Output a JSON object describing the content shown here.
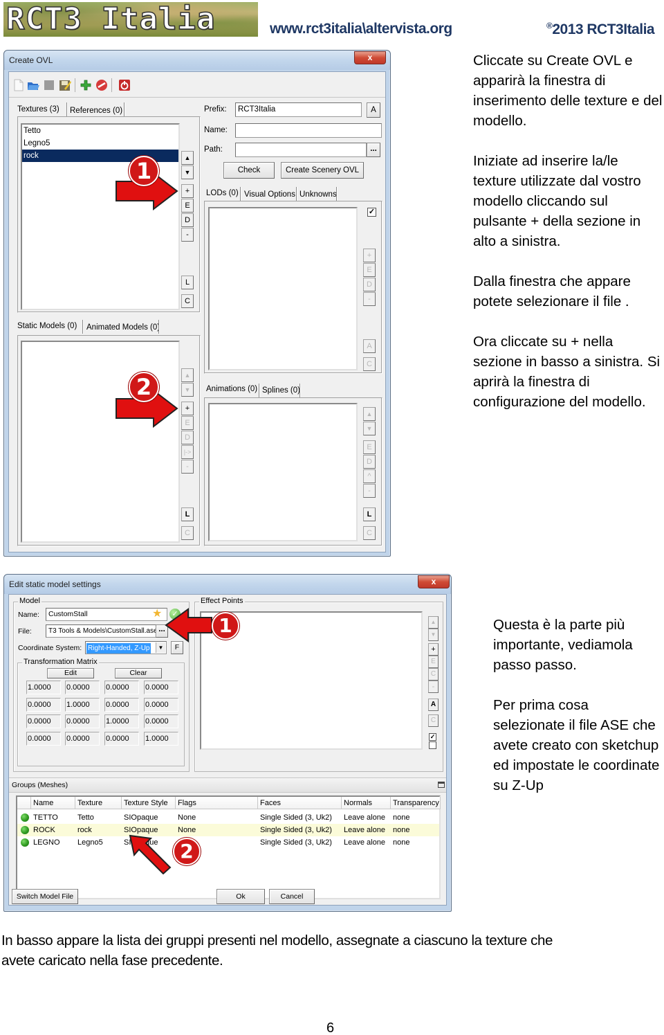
{
  "header": {
    "logo_text": "RCT3 Italia",
    "site_url": "www.rct3italia\\altervista.org",
    "copyright_symbol": "®",
    "copyright_text": "2013 RCT3Italia"
  },
  "dialog1": {
    "title": "Create OVL",
    "close_label": "x",
    "toolbar": [
      {
        "icon": "new-file-icon"
      },
      {
        "icon": "open-folder-icon"
      },
      {
        "icon": "save-disabled-icon"
      },
      {
        "icon": "save-as-icon"
      },
      {
        "icon": "add-icon"
      },
      {
        "icon": "remove-icon"
      },
      {
        "icon": "power-exit-icon"
      }
    ],
    "textures_tab": "Textures (3)",
    "references_tab": "References (0)",
    "textures": [
      {
        "label": "Tetto",
        "selected": false
      },
      {
        "label": "Legno5",
        "selected": false
      },
      {
        "label": "rock",
        "selected": true
      }
    ],
    "texture_side_buttons": [
      "▲",
      "▼",
      "+",
      "E",
      "D",
      "-"
    ],
    "texture_bottom_buttons": [
      "L",
      "C"
    ],
    "prefix_label": "Prefix:",
    "prefix_value": "RCT3Italia",
    "prefix_button": "A",
    "name_label": "Name:",
    "name_value": "",
    "path_label": "Path:",
    "path_value": "",
    "path_browse": "...",
    "check_button": "Check",
    "create_button": "Create Scenery OVL",
    "lods_tab": "LODs (0)",
    "visual_tab": "Visual Options",
    "unknowns_tab": "Unknowns",
    "lods_checkbox_checked": true,
    "lods_side_buttons": [
      "+",
      "E",
      "D",
      "-"
    ],
    "lods_bottom_buttons": [
      "A",
      "C"
    ],
    "static_tab": "Static Models (0)",
    "animated_tab": "Animated Models (0)",
    "models_side_buttons": [
      "▲",
      "▼",
      "+",
      "E",
      "D",
      "|->",
      "-"
    ],
    "models_bottom_buttons": [
      "L",
      "C"
    ],
    "animations_tab": "Animations (0)",
    "splines_tab": "Splines (0)",
    "anim_side_buttons": [
      "▲",
      "▼",
      "E",
      "D",
      "^",
      "-"
    ],
    "anim_bottom_buttons": [
      "L",
      "C"
    ],
    "marker1": "1",
    "marker2": "2"
  },
  "text1": {
    "paragraphs": [
      "Cliccate su Create OVL e apparirà la finestra di inserimento delle texture e del modello.",
      "Iniziate ad inserire la/le texture utilizzate dal vostro modello cliccando sul pulsante + della sezione in alto a sinistra.",
      "Dalla finestra che appare potete selezionare il file .",
      "Ora cliccate su + nella sezione in basso a sinistra. Si aprirà la finestra di configurazione del modello."
    ]
  },
  "dialog2": {
    "title": "Edit static model settings",
    "close_label": "x",
    "model_group": "Model",
    "name_label": "Name:",
    "name_value": "CustomStall",
    "file_label": "File:",
    "file_value": "T3 Tools & Models\\CustomStall.ase",
    "file_browse": "...",
    "coord_label": "Coordinate System:",
    "coord_value": "Right-Handed, Z-Up",
    "coord_f_button": "F",
    "matrix_group": "Transformation Matrix",
    "edit_button": "Edit",
    "clear_button": "Clear",
    "matrix": [
      [
        "1.0000",
        "0.0000",
        "0.0000",
        "0.0000"
      ],
      [
        "0.0000",
        "1.0000",
        "0.0000",
        "0.0000"
      ],
      [
        "0.0000",
        "0.0000",
        "1.0000",
        "0.0000"
      ],
      [
        "0.0000",
        "0.0000",
        "0.0000",
        "1.0000"
      ]
    ],
    "effect_group": "Effect Points",
    "effect_side_buttons": [
      "▲",
      "▼",
      "+",
      "E",
      "C",
      "-"
    ],
    "effect_bottom_buttons": [
      "A",
      "C"
    ],
    "effect_check1": true,
    "effect_check2": false,
    "groups_title": "Groups (Meshes)",
    "columns": [
      "Name",
      "Texture",
      "Texture Style",
      "Flags",
      "Faces",
      "Normals",
      "Transparency"
    ],
    "rows": [
      {
        "status": "ok",
        "cells": [
          "TETTO",
          "Tetto",
          "SIOpaque",
          "None",
          "Single Sided (3, Uk2)",
          "Leave alone",
          "none"
        ],
        "highlight": false
      },
      {
        "status": "ok",
        "cells": [
          "ROCK",
          "rock",
          "SIOpaque",
          "None",
          "Single Sided (3, Uk2)",
          "Leave alone",
          "none"
        ],
        "highlight": true
      },
      {
        "status": "ok",
        "cells": [
          "LEGNO",
          "Legno5",
          "SIOpaque",
          "None",
          "Single Sided (3, Uk2)",
          "Leave alone",
          "none"
        ],
        "highlight": false
      }
    ],
    "switch_button": "Switch Model File",
    "ok_button": "Ok",
    "cancel_button": "Cancel",
    "marker1": "1",
    "marker2": "2"
  },
  "text2": {
    "paragraphs": [
      "Questa è la parte più importante, vediamola passo passo.",
      "Per prima cosa selezionate il file ASE che avete creato con sketchup ed impostate le coordinate su Z-Up"
    ]
  },
  "text3": {
    "paragraph": "In basso appare la lista dei gruppi presenti nel modello, assegnate a ciascuno la texture che avete caricato nella fase precedente."
  },
  "page_number": "6",
  "colors": {
    "header_blue": "#1f3864",
    "marker_red": "#d01818",
    "selection_blue": "#0a2a5e",
    "row_highlight": "#fbfbd9"
  }
}
